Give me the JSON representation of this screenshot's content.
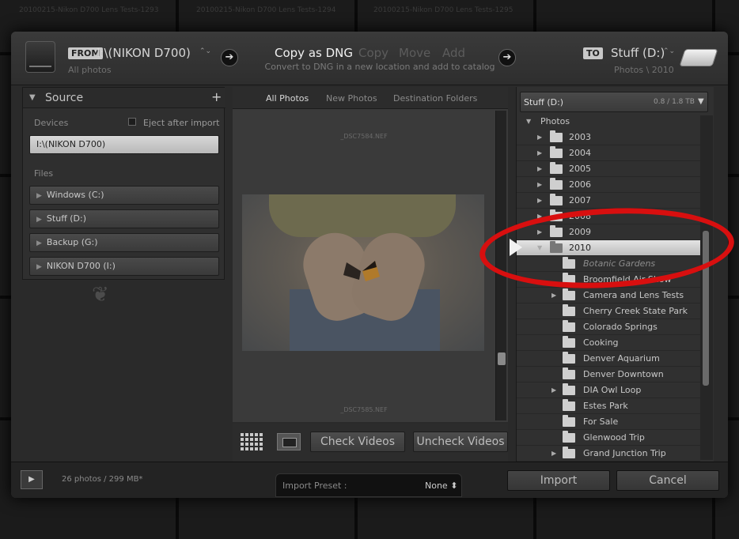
{
  "background_tiles": [
    "20100215-Nikon D700 Lens Tests-1293",
    "20100215-Nikon D700 Lens Tests-1294",
    "20100215-Nikon D700 Lens Tests-1295"
  ],
  "header": {
    "from_badge": "FROM",
    "source_name": "I:\\(NIKON D700)",
    "source_chevron": "⌃⌄",
    "source_sub": "All photos",
    "modes": [
      {
        "label": "Copy as DNG",
        "active": true
      },
      {
        "label": "Copy",
        "active": false
      },
      {
        "label": "Move",
        "active": false
      },
      {
        "label": "Add",
        "active": false
      }
    ],
    "mode_description": "Convert to DNG in a new location and add to catalog",
    "to_badge": "TO",
    "dest_name": "Stuff (D:)",
    "dest_chevron": "⌃⌄",
    "dest_sub": "Photos \\ 2010"
  },
  "source_panel": {
    "title": "Source",
    "add_icon": "+",
    "devices_label": "Devices",
    "eject_label": "Eject after import",
    "device": "I:\\(NIKON D700)",
    "files_label": "Files",
    "drives": [
      "Windows (C:)",
      "Stuff (D:)",
      "Backup (G:)",
      "NIKON D700 (I:)"
    ]
  },
  "center": {
    "tabs": [
      "All Photos",
      "New Photos",
      "Destination Folders"
    ],
    "active_tab": "All Photos",
    "file_top": "_DSC7584.NEF",
    "file_bottom": "_DSC7585.NEF",
    "check_videos": "Check Videos",
    "uncheck_videos": "Uncheck Videos"
  },
  "destination_panel": {
    "drive": "Stuff (D:)",
    "drive_space": "0.8 / 1.8 TB",
    "root": "Photos",
    "years": [
      "2003",
      "2004",
      "2005",
      "2006",
      "2007",
      "2008",
      "2009",
      "2010"
    ],
    "selected": "2010",
    "subfolders": [
      {
        "name": "Botanic Gardens",
        "new": true,
        "expandable": false
      },
      {
        "name": "Broomfield Air Show",
        "new": false,
        "expandable": false
      },
      {
        "name": "Camera and Lens Tests",
        "new": false,
        "expandable": true
      },
      {
        "name": "Cherry Creek State Park",
        "new": false,
        "expandable": false
      },
      {
        "name": "Colorado Springs",
        "new": false,
        "expandable": false
      },
      {
        "name": "Cooking",
        "new": false,
        "expandable": false
      },
      {
        "name": "Denver Aquarium",
        "new": false,
        "expandable": false
      },
      {
        "name": "Denver Downtown",
        "new": false,
        "expandable": false
      },
      {
        "name": "DIA Owl Loop",
        "new": false,
        "expandable": true
      },
      {
        "name": "Estes Park",
        "new": false,
        "expandable": false
      },
      {
        "name": "For Sale",
        "new": false,
        "expandable": false
      },
      {
        "name": "Glenwood Trip",
        "new": false,
        "expandable": false
      },
      {
        "name": "Grand Junction Trip",
        "new": false,
        "expandable": true
      }
    ]
  },
  "footer": {
    "summary": "26 photos / 299 MB*",
    "preset_label": "Import Preset :",
    "preset_value": "None ⬍",
    "import": "Import",
    "cancel": "Cancel"
  },
  "colors": {
    "highlight": "#d80f0f",
    "selected_row": "#e4e4e4"
  }
}
